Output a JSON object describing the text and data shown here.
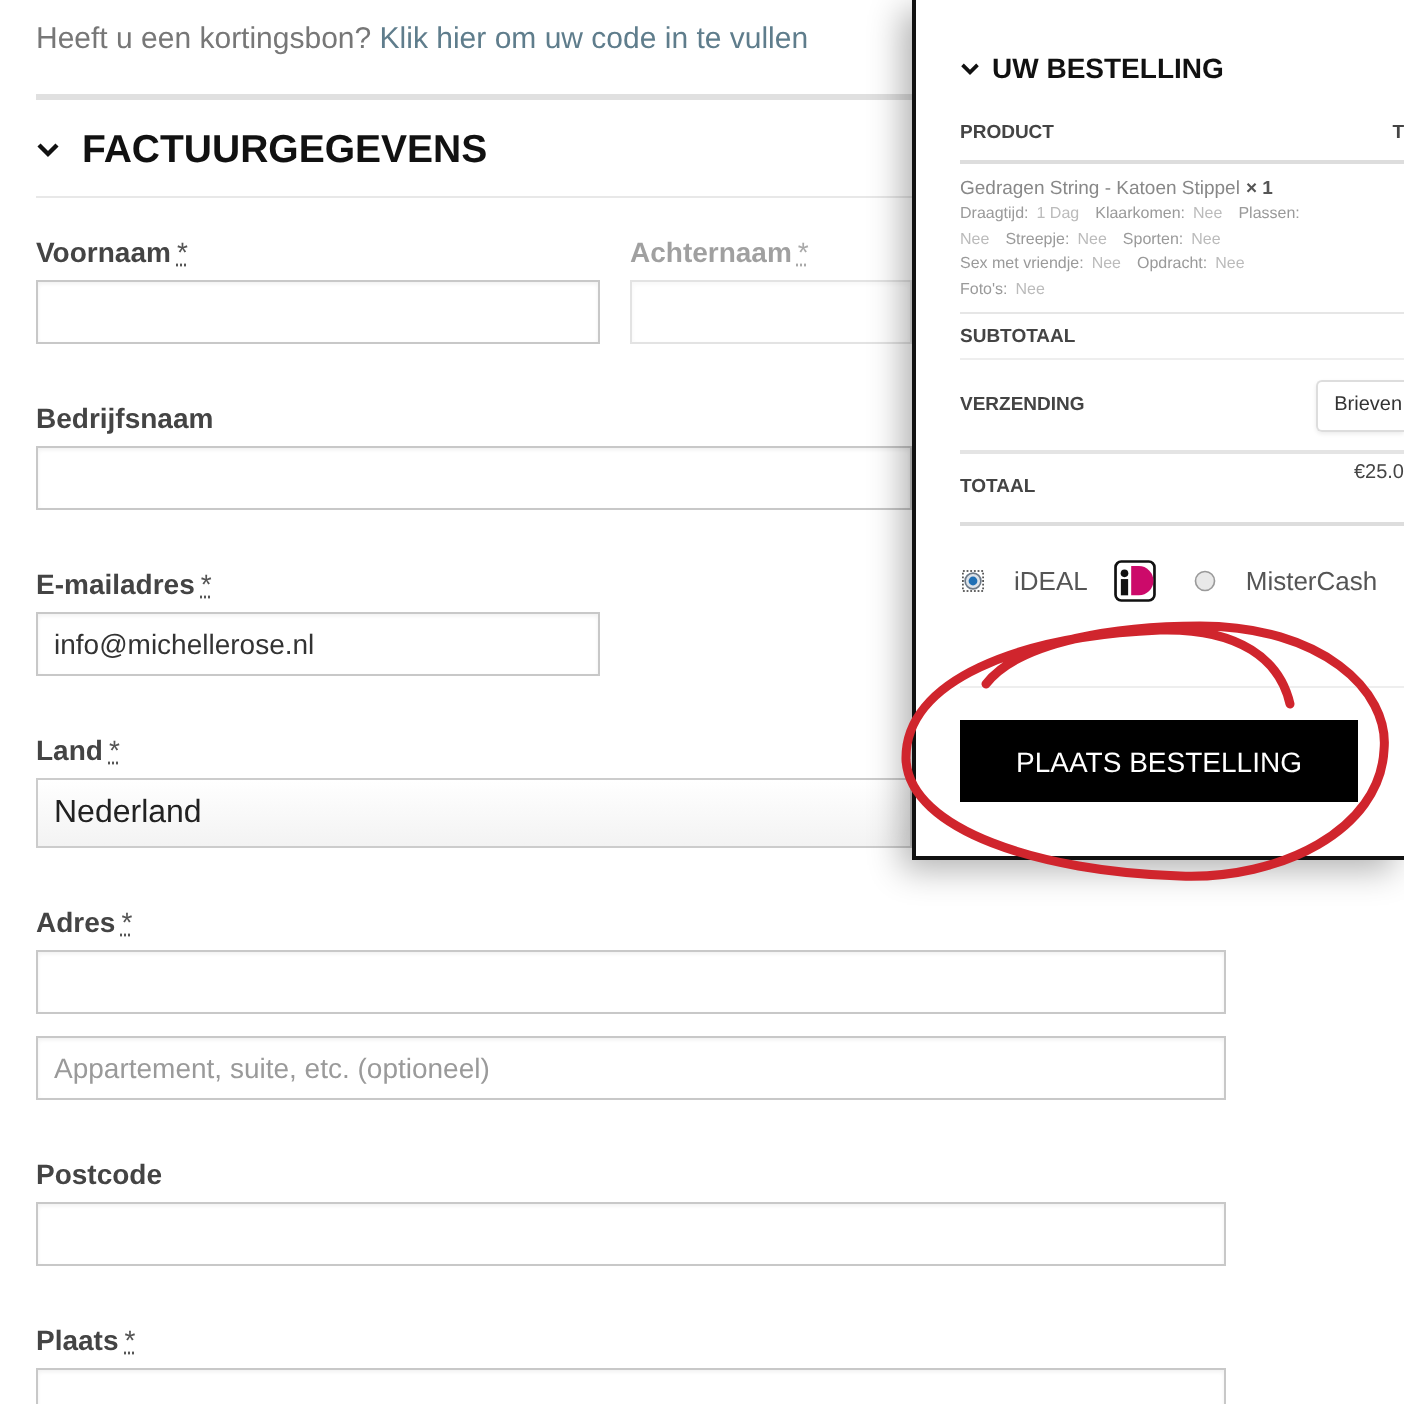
{
  "coupon": {
    "text": "Heeft u een kortingsbon?",
    "link": "Klik hier om uw code in te vullen"
  },
  "billing": {
    "title": "FACTUURGEGEVENS",
    "fields": [
      {
        "label": "Voornaam",
        "required_mark": "*",
        "kind": "short",
        "faded": false
      },
      {
        "label": "Achternaam",
        "required_mark": "*",
        "kind": "short",
        "faded": true
      },
      {
        "label": "Bedrijfsnaam",
        "kind": "long",
        "faded": false
      },
      {
        "label": "E-mailadres",
        "required_mark": "*",
        "kind": "short",
        "value": "info@michellerose.nl",
        "faded": false
      },
      {
        "label": "Land",
        "required_mark": "*",
        "kind": "select",
        "value": "Nederland",
        "faded": false
      },
      {
        "label": "Adres",
        "required_mark": "*",
        "kind": "long",
        "faded": false
      },
      {
        "kind": "long",
        "placeholder": "Appartement, suite, etc. (optioneel)",
        "faded": false
      },
      {
        "label": "Postcode",
        "kind": "long",
        "faded": false
      },
      {
        "label": "Plaats",
        "required_mark": "*",
        "kind": "long",
        "faded": false
      }
    ]
  },
  "order": {
    "title": "UW BESTELLING",
    "columns": [
      "PRODUCT",
      "T"
    ],
    "items": [
      {
        "name": "Gedragen String - Katoen Stippel",
        "quantity": "× 1",
        "meta": [
          {
            "key": "Draagtijd:",
            "value": "1 Dag"
          },
          {
            "key": "Klaarkomen:",
            "value": "Nee"
          },
          {
            "key": "Plassen:",
            "value": "Nee"
          },
          {
            "key": "Streepje:",
            "value": "Nee"
          },
          {
            "key": "Sporten:",
            "value": "Nee"
          },
          {
            "key": "Sex met vriendje:",
            "value": "Nee"
          },
          {
            "key": "Opdracht:",
            "value": "Nee"
          },
          {
            "key": "Foto's:",
            "value": "Nee"
          }
        ]
      }
    ],
    "subtotal": {
      "label": "SUBTOTAAL"
    },
    "shipping": {
      "label": "VERZENDING",
      "value": "Brieven"
    },
    "total": {
      "label": "TOTAAL",
      "value": "€25.0"
    },
    "payment_methods": [
      {
        "label": "iDEAL",
        "selected": true,
        "logo": true
      },
      {
        "label": "MisterCash",
        "selected": false,
        "logo": false
      }
    ],
    "place_order": "PLAATS BESTELLING"
  }
}
